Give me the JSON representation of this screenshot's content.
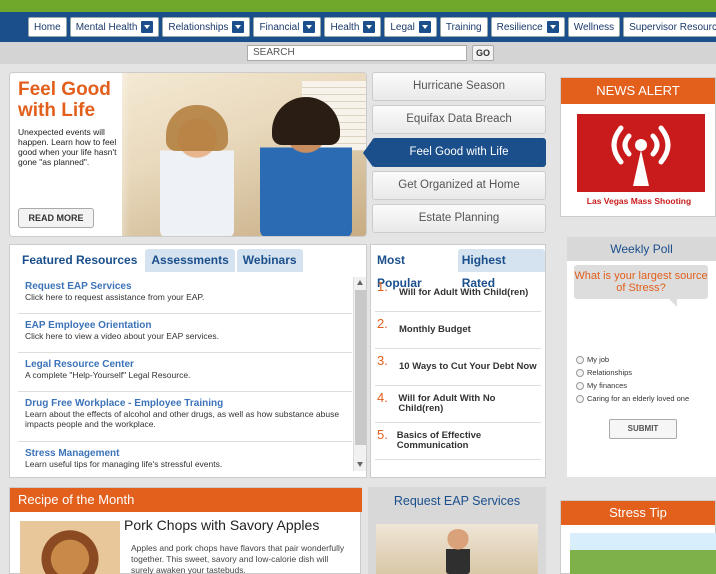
{
  "nav": {
    "items": [
      {
        "label": "Home",
        "dropdown": false
      },
      {
        "label": "Mental Health",
        "dropdown": true
      },
      {
        "label": "Relationships",
        "dropdown": true
      },
      {
        "label": "Financial",
        "dropdown": true
      },
      {
        "label": "Health",
        "dropdown": true
      },
      {
        "label": "Legal",
        "dropdown": true
      },
      {
        "label": "Training",
        "dropdown": false
      },
      {
        "label": "Resilience",
        "dropdown": true
      },
      {
        "label": "Wellness",
        "dropdown": false
      },
      {
        "label": "Supervisor Resources",
        "dropdown": false
      }
    ]
  },
  "search": {
    "placeholder": "SEARCH",
    "go_label": "GO"
  },
  "hero": {
    "title": "Feel Good with Life",
    "description": "Unexpected events will happen. Learn how to feel good when your life hasn't gone \"as planned\".",
    "button": "READ MORE"
  },
  "hero_tabs": [
    "Hurricane Season",
    "Equifax Data Breach",
    "Feel Good with Life",
    "Get Organized at Home",
    "Estate Planning"
  ],
  "featured": {
    "tabs": [
      "Featured Resources",
      "Assessments",
      "Webinars"
    ],
    "items": [
      {
        "title": "Request EAP Services",
        "desc": "Click here to request assistance from your EAP."
      },
      {
        "title": "EAP Employee Orientation",
        "desc": "Click here to view a video about your EAP services."
      },
      {
        "title": "Legal Resource Center",
        "desc": "A complete \"Help-Yourself\" Legal Resource."
      },
      {
        "title": "Drug Free Workplace - Employee Training",
        "desc": "Learn about the effects of alcohol and other drugs, as well as how substance abuse impacts people and the workplace."
      },
      {
        "title": "Stress Management",
        "desc": "Learn useful tips for managing life's stressful events."
      }
    ]
  },
  "popular": {
    "tabs": [
      "Most Popular",
      "Highest Rated"
    ],
    "items": [
      {
        "num": "1.",
        "text": "Will for Adult With Child(ren)"
      },
      {
        "num": "2.",
        "text": "Monthly Budget"
      },
      {
        "num": "3.",
        "text": "10 Ways to Cut Your Debt Now"
      },
      {
        "num": "4.",
        "text": "Will for Adult With No Child(ren)"
      },
      {
        "num": "5.",
        "text": "Basics of Effective Communication"
      }
    ]
  },
  "recipe": {
    "header": "Recipe of the Month",
    "title": "Pork Chops with Savory Apples",
    "desc": "Apples and pork chops have flavors that pair wonderfully together. This sweet, savory and low-calorie dish will surely awaken your tastebuds."
  },
  "request": {
    "header": "Request EAP Services"
  },
  "news": {
    "header": "NEWS ALERT",
    "caption": "Las Vegas Mass Shooting"
  },
  "poll": {
    "header": "Weekly Poll",
    "question": "What is your largest source of Stress?",
    "options": [
      "My job",
      "Relationships",
      "My finances",
      "Caring for an elderly loved one"
    ],
    "submit": "SUBMIT"
  },
  "tip": {
    "header": "Stress Tip"
  }
}
